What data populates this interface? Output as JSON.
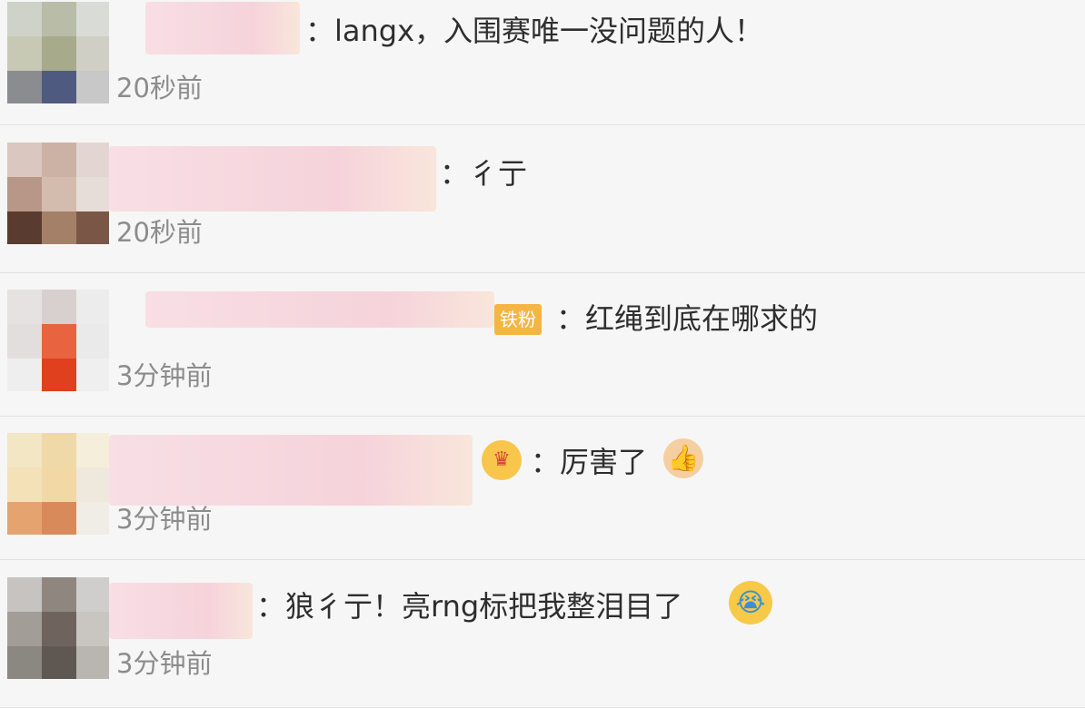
{
  "comments": [
    {
      "text": "：langx，入围赛唯一没问题的人！",
      "time": "20秒前"
    },
    {
      "text": "：彳亍",
      "time": "20秒前"
    },
    {
      "badge": "铁粉",
      "text": "：红绳到底在哪求的",
      "time": "3分钟前"
    },
    {
      "text": "：厉害了",
      "emoji_after": "thumbs-up-icon",
      "time": "3分钟前"
    },
    {
      "text": "：狼彳亍！亮rng标把我整泪目了",
      "emoji_after": "crying-face-icon",
      "time": "3分钟前"
    }
  ]
}
